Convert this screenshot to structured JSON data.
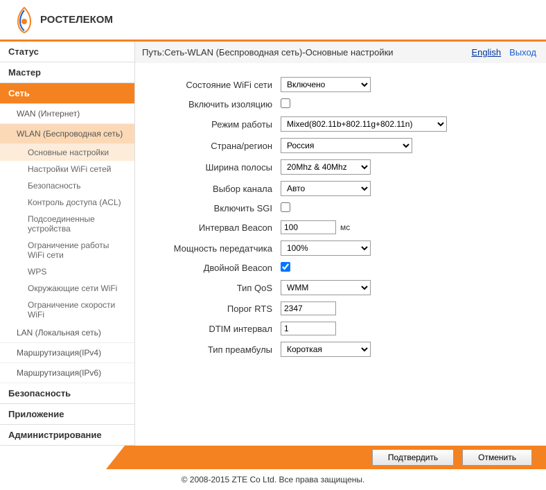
{
  "logo_text": "РОСТЕЛЕКОМ",
  "breadcrumb": "Путь:Сеть-WLAN (Беспроводная сеть)-Основные настройки",
  "top_links": {
    "english": "English",
    "exit": "Выход"
  },
  "nav": {
    "status": "Статус",
    "master": "Мастер",
    "network": "Сеть",
    "wan": "WAN (Интернет)",
    "wlan": "WLAN (Беспроводная сеть)",
    "wlan_items": {
      "basic": "Основные настройки",
      "wifi_settings": "Настройки WiFi сетей",
      "security": "Безопасность",
      "acl": "Контроль доступа (ACL)",
      "connected": "Подсоединенные устройства",
      "limit": "Ограничение работы WiFi сети",
      "wps": "WPS",
      "surrounding": "Окружающие сети WiFi",
      "speed": "Ограничение скорости WiFi"
    },
    "lan": "LAN (Локальная сеть)",
    "routing4": "Маршрутизация(IPv4)",
    "routing6": "Маршрутизация(IPv6)",
    "security_main": "Безопасность",
    "app": "Приложение",
    "admin": "Администрирование"
  },
  "form": {
    "wifi_state": {
      "label": "Состояние WiFi сети",
      "value": "Включено"
    },
    "isolation": {
      "label": "Включить изоляцию"
    },
    "mode": {
      "label": "Режим работы",
      "value": "Mixed(802.11b+802.11g+802.11n)"
    },
    "country": {
      "label": "Страна/регион",
      "value": "Россия"
    },
    "bandwidth": {
      "label": "Ширина полосы",
      "value": "20Mhz & 40Mhz"
    },
    "channel": {
      "label": "Выбор канала",
      "value": "Авто"
    },
    "sgi": {
      "label": "Включить SGI"
    },
    "beacon": {
      "label": "Интервал Beacon",
      "value": "100",
      "unit": "мс"
    },
    "power": {
      "label": "Мощность передатчика",
      "value": "100%"
    },
    "double_beacon": {
      "label": "Двойной Beacon"
    },
    "qos": {
      "label": "Тип QoS",
      "value": "WMM"
    },
    "rts": {
      "label": "Порог RTS",
      "value": "2347"
    },
    "dtim": {
      "label": "DTIM интервал",
      "value": "1"
    },
    "preamble": {
      "label": "Тип преамбулы",
      "value": "Короткая"
    }
  },
  "buttons": {
    "submit": "Подтвердить",
    "cancel": "Отменить"
  },
  "copyright": "© 2008-2015 ZTE Co Ltd. Все права защищены."
}
